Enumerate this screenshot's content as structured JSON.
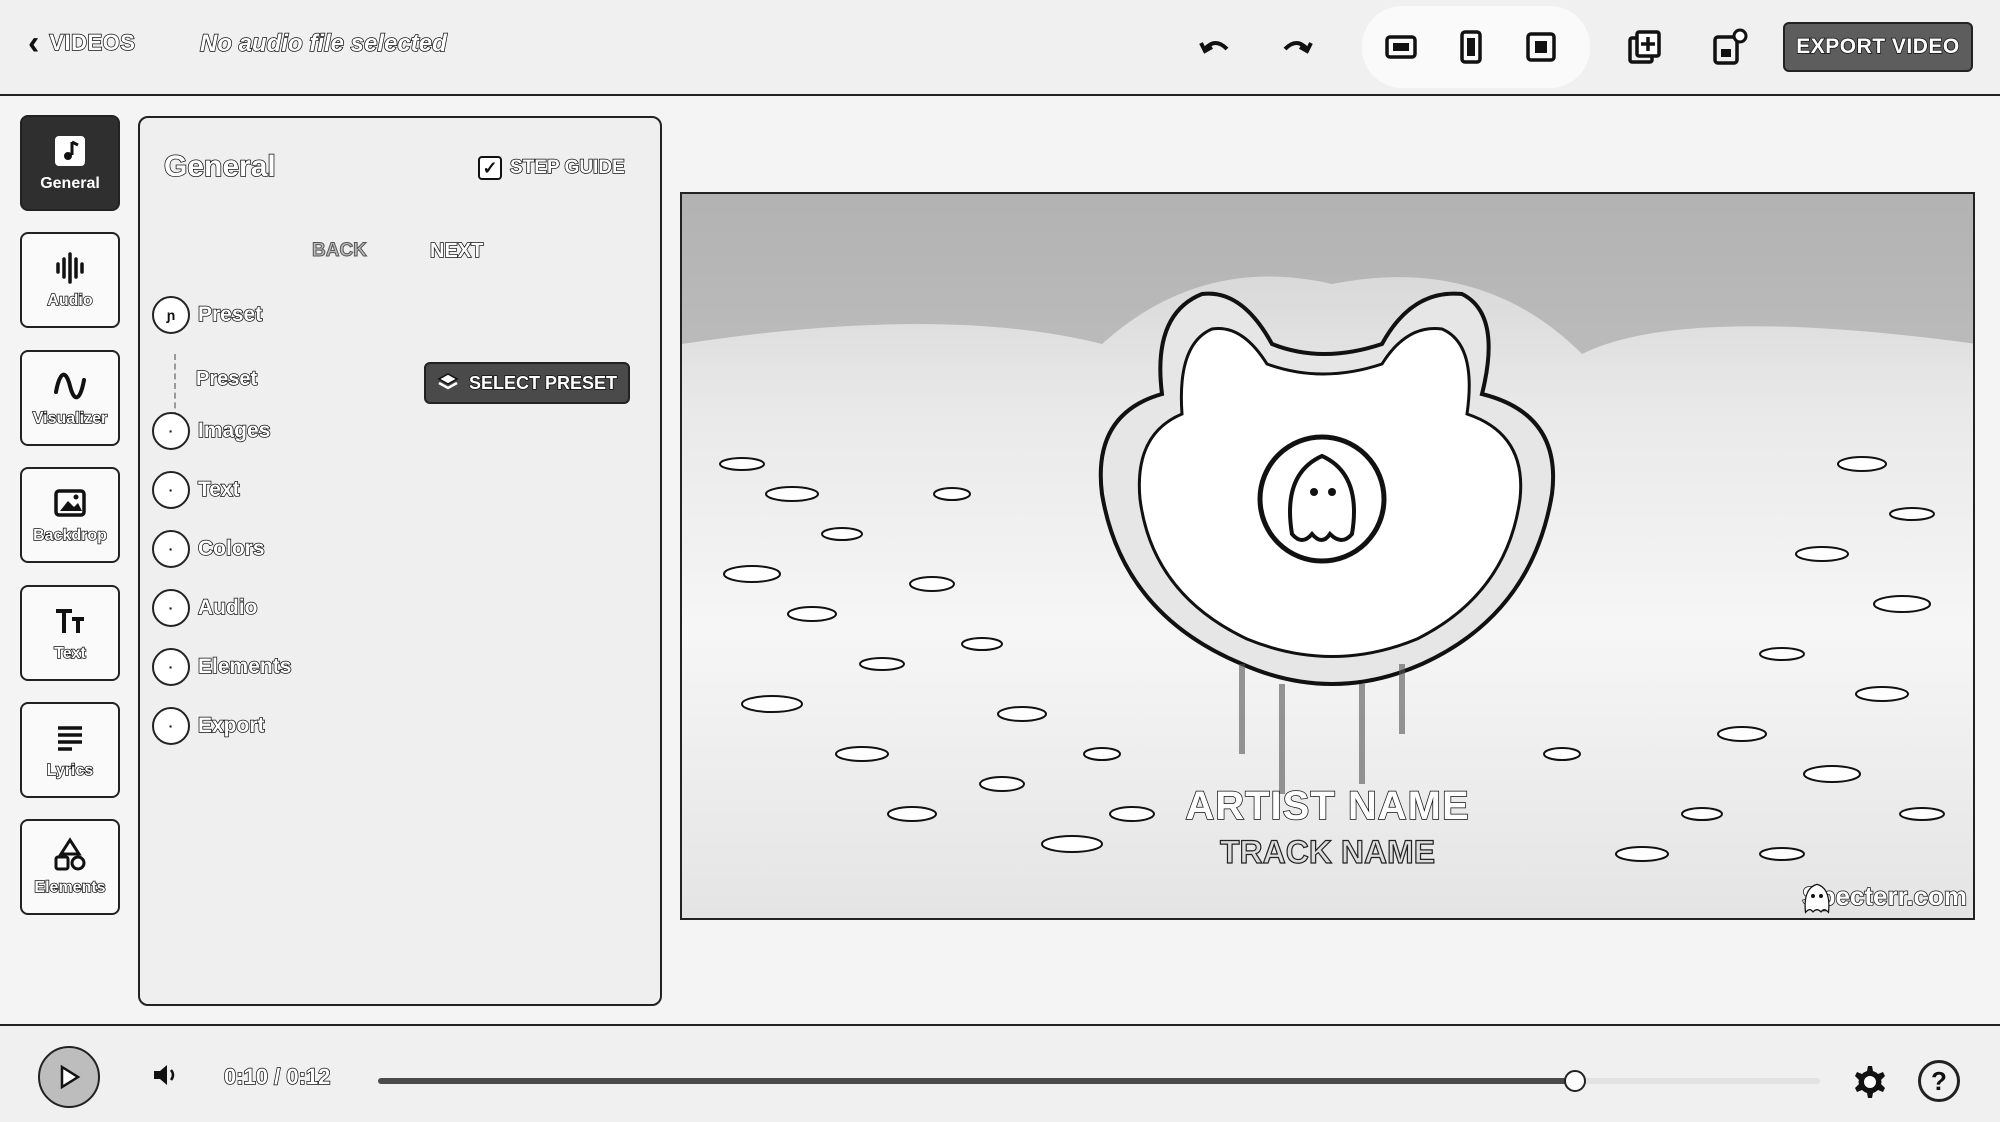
{
  "topbar": {
    "back_label": "VIDEOS",
    "audio_status": "No audio file selected",
    "export_label": "EXPORT VIDEO",
    "icons": [
      "undo-icon",
      "redo-icon",
      "landscape-ratio-icon",
      "portrait-ratio-icon",
      "square-ratio-icon",
      "add-layer-icon",
      "notifications-icon"
    ]
  },
  "rail": {
    "items": [
      {
        "label": "General",
        "icon": "music-note-icon",
        "active": true
      },
      {
        "label": "Audio",
        "icon": "waveform-icon",
        "active": false
      },
      {
        "label": "Visualizer",
        "icon": "wave-icon",
        "active": false
      },
      {
        "label": "Backdrop",
        "icon": "image-icon",
        "active": false
      },
      {
        "label": "Text",
        "icon": "text-size-icon",
        "active": false
      },
      {
        "label": "Lyrics",
        "icon": "lines-icon",
        "active": false
      },
      {
        "label": "Elements",
        "icon": "shapes-icon",
        "active": false
      }
    ]
  },
  "panel": {
    "title": "General",
    "step_guide_label": "STEP GUIDE",
    "step_guide_checked": true,
    "back_label": "BACK",
    "next_label": "NEXT",
    "steps": [
      {
        "label": "Preset"
      },
      {
        "label": "Images"
      },
      {
        "label": "Text"
      },
      {
        "label": "Colors"
      },
      {
        "label": "Audio"
      },
      {
        "label": "Elements"
      },
      {
        "label": "Export"
      }
    ],
    "sub_preset_label": "Preset",
    "select_preset_label": "SELECT PRESET"
  },
  "preview": {
    "artist": "ARTIST NAME",
    "track": "TRACK NAME",
    "watermark": "Specterr.com"
  },
  "player": {
    "time": "0:10 / 0:12",
    "progress": 0.83
  }
}
